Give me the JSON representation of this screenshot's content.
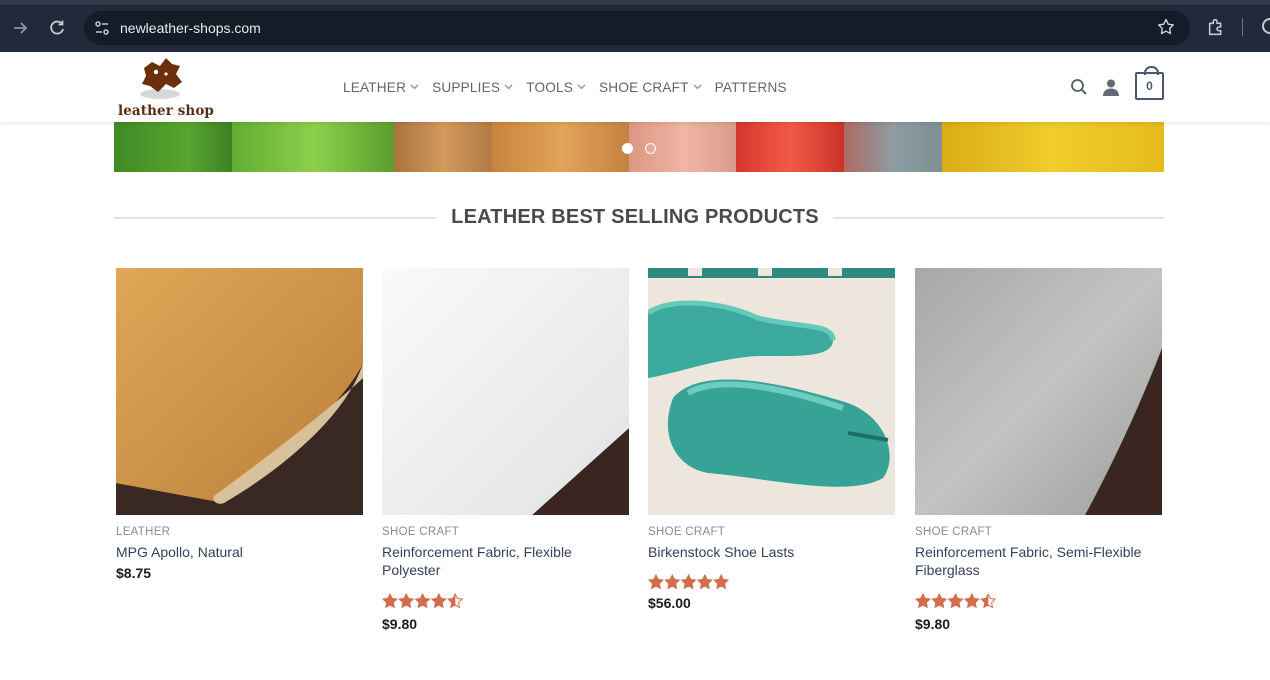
{
  "browser": {
    "url": "newleather-shops.com",
    "icons": [
      "forward-icon",
      "reload-icon",
      "site-info-icon",
      "bookmark-star-icon",
      "extensions-icon"
    ]
  },
  "header": {
    "logo_text": "leather shop",
    "nav": [
      {
        "label": "LEATHER",
        "has_dropdown": true
      },
      {
        "label": "SUPPLIES",
        "has_dropdown": true
      },
      {
        "label": "TOOLS",
        "has_dropdown": true
      },
      {
        "label": "SHOE CRAFT",
        "has_dropdown": true
      },
      {
        "label": "PATTERNS",
        "has_dropdown": false
      }
    ],
    "cart_count": "0",
    "icons": [
      "search-icon",
      "account-icon",
      "cart-icon"
    ]
  },
  "hero": {
    "slides": 2,
    "active_slide": 1,
    "colors": [
      "#4f9a2c",
      "#7dc43e",
      "#c58a4e",
      "#d8944a",
      "#e9a592",
      "#e7463a",
      "#9aa3a6",
      "#e8c21e"
    ]
  },
  "section": {
    "title": "LEATHER BEST SELLING PRODUCTS"
  },
  "products": [
    {
      "category": "LEATHER",
      "name": "MPG Apollo, Natural",
      "rating": null,
      "price": "$8.75",
      "image": "tan-leather-sheet"
    },
    {
      "category": "SHOE CRAFT",
      "name": "Reinforcement Fabric, Flexible Polyester",
      "rating": 4.5,
      "price": "$9.80",
      "image": "white-fabric-sheet"
    },
    {
      "category": "SHOE CRAFT",
      "name": "Birkenstock Shoe Lasts",
      "rating": 5,
      "price": "$56.00",
      "image": "teal-shoe-lasts"
    },
    {
      "category": "SHOE CRAFT",
      "name": "Reinforcement Fabric, Semi-Flexible Fiberglass",
      "rating": 4.5,
      "price": "$9.80",
      "image": "grey-fiberglass-sheet"
    }
  ],
  "colors": {
    "chrome_bg": "#202a3a",
    "nav_text": "#5f6670",
    "star": "#d26e4b",
    "product_name": "#33415c"
  }
}
